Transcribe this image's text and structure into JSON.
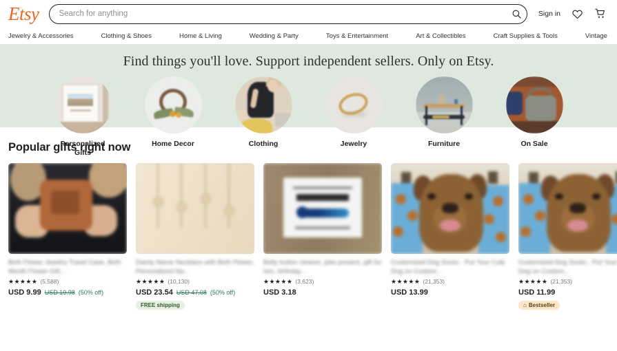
{
  "header": {
    "logo_text": "Etsy",
    "search": {
      "placeholder": "Search for anything",
      "value": "",
      "icon": "search-icon"
    },
    "sign_in_label": "Sign in",
    "favorites_icon": "heart-icon",
    "cart_icon": "shopping-cart-icon"
  },
  "category_nav": {
    "items": [
      {
        "label": "Jewelry & Accessories"
      },
      {
        "label": "Clothing & Shoes"
      },
      {
        "label": "Home & Living"
      },
      {
        "label": "Wedding & Party"
      },
      {
        "label": "Toys & Entertainment"
      },
      {
        "label": "Art & Collectibles"
      },
      {
        "label": "Craft Supplies & Tools"
      },
      {
        "label": "Vintage"
      }
    ]
  },
  "banner": {
    "background_color": "#dde8df",
    "title": "Find things you'll love. Support independent sellers. Only on Etsy.",
    "circles": [
      {
        "label": "Personalized Gifts",
        "art": "art-gifts"
      },
      {
        "label": "Home Decor",
        "art": "art-decor"
      },
      {
        "label": "Clothing",
        "art": "art-clothing"
      },
      {
        "label": "Jewelry",
        "art": "art-jewelry"
      },
      {
        "label": "Furniture",
        "art": "art-furn"
      },
      {
        "label": "On Sale",
        "art": "art-sale"
      }
    ]
  },
  "main": {
    "section_title": "Popular gifts right now",
    "products": [
      {
        "title": "Birth Flower Jewelry Travel Case, Birth Month Flower Gift...",
        "stars": "★★★★★",
        "rating_count": "(5,588)",
        "price": "USD 9.99",
        "price_original": "USD 19.98",
        "discount": "(50% off)",
        "badge": "",
        "badge_icon": ""
      },
      {
        "title": "Dainty Name Necklace with Birth Flower, Personalized Na...",
        "stars": "★★★★★",
        "rating_count": "(10,130)",
        "price": "USD 23.54",
        "price_original": "USD 47.08",
        "discount": "(50% off)",
        "badge": "FREE shipping",
        "badge_icon": ""
      },
      {
        "title": "Belly button cleaner, joke present, gift for him, birthday...",
        "stars": "★★★★★",
        "rating_count": "(3,623)",
        "price": "USD 3.18",
        "price_original": "",
        "discount": "",
        "badge": "",
        "badge_icon": ""
      },
      {
        "title": "Customized Dog Socks - Put Your Cute Dog on Custom...",
        "stars": "★★★★★",
        "rating_count": "(21,353)",
        "price": "USD 13.99",
        "price_original": "",
        "discount": "",
        "badge": "",
        "badge_icon": ""
      },
      {
        "title": "Customized Dog Socks - Put Your Cute Dog on Custom...",
        "stars": "★★★★★",
        "rating_count": "(21,353)",
        "price": "USD 11.99",
        "price_original": "",
        "discount": "",
        "badge": "Bestseller",
        "badge_icon": "⌂"
      }
    ]
  }
}
